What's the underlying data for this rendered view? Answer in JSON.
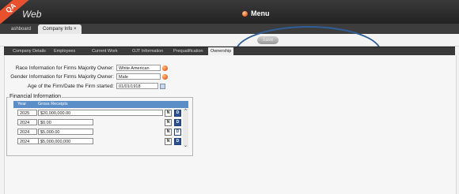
{
  "qa_ribbon": "QA",
  "app_title": "Web",
  "menu_label": "Menu",
  "main_tabs": [
    "ashboard",
    "Company Info"
  ],
  "main_tab_close": "×",
  "save_label": "Save",
  "nav_tabs": [
    "Company Details",
    "Employees",
    "Current Work",
    "OJT Information",
    "Prequalification",
    "Ownership"
  ],
  "form": {
    "race_label": "Race Information for Firms Majority Owner:",
    "race_value": "White American",
    "gender_label": "Gender Information for Firms Majority Owner:",
    "gender_value": "Male",
    "age_label": "Age of the Firm/Date the Firm started:",
    "age_value": "01/01/1918"
  },
  "financial": {
    "legend": "Financial Information",
    "columns": [
      "Year",
      "Gross Receipts"
    ],
    "rows": [
      {
        "year": "2025",
        "gross": "$20,000,000.00",
        "n": "N",
        "d": "D"
      },
      {
        "year": "2024",
        "gross": "$0.00",
        "n": "N",
        "d": "D"
      },
      {
        "year": "2024",
        "gross": "$5,000.00",
        "n": "N",
        "d": "D"
      },
      {
        "year": "2024",
        "gross": "$5,000,000,000",
        "n": "N",
        "d": "D"
      }
    ]
  }
}
